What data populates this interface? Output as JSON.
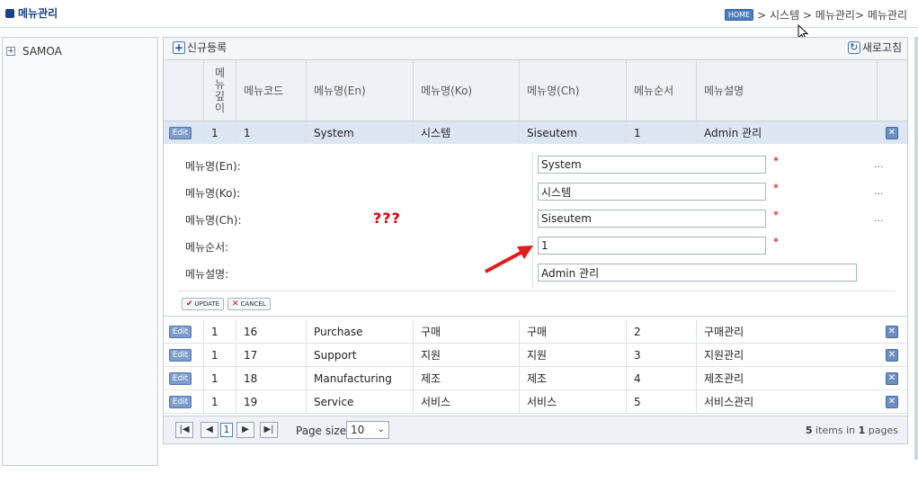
{
  "header": {
    "title": "메뉴관리",
    "breadcrumb": {
      "home_label": "HOME",
      "path": "> 시스템 > 메뉴관리> 메뉴관리"
    }
  },
  "sidebar": {
    "items": [
      {
        "label": "SAMOA",
        "expander": "+"
      }
    ]
  },
  "toolbar": {
    "new_label": "신규등록",
    "refresh_label": "새로고침"
  },
  "grid": {
    "columns": {
      "depth": [
        "메",
        "뉴",
        "깊",
        "이"
      ],
      "code": "메뉴코드",
      "name_en": "메뉴명(En)",
      "name_ko": "메뉴명(Ko)",
      "name_ch": "메뉴명(Ch)",
      "order": "메뉴순서",
      "desc": "메뉴설명"
    },
    "edit_label": "Edit",
    "delete_glyph": "✕",
    "selected_row": {
      "depth": "1",
      "code": "1",
      "name_en": "System",
      "name_ko": "시스템",
      "name_ch": "Siseutem",
      "order": "1",
      "desc": "Admin 관리"
    },
    "rows": [
      {
        "depth": "1",
        "code": "16",
        "name_en": "Purchase",
        "name_ko": "구매",
        "name_ch": "구매",
        "order": "2",
        "desc": "구매관리"
      },
      {
        "depth": "1",
        "code": "17",
        "name_en": "Support",
        "name_ko": "지원",
        "name_ch": "지원",
        "order": "3",
        "desc": "지원관리"
      },
      {
        "depth": "1",
        "code": "18",
        "name_en": "Manufacturing",
        "name_ko": "제조",
        "name_ch": "제조",
        "order": "4",
        "desc": "제조관리"
      },
      {
        "depth": "1",
        "code": "19",
        "name_en": "Service",
        "name_ko": "서비스",
        "name_ch": "서비스",
        "order": "5",
        "desc": "서비스관리"
      }
    ]
  },
  "edit_form": {
    "labels": {
      "name_en": "메뉴명(En):",
      "name_ko": "메뉴명(Ko):",
      "name_ch": "메뉴명(Ch):",
      "order": "메뉴순서:",
      "desc": "메뉴설명:"
    },
    "values": {
      "name_en": "System",
      "name_ko": "시스템",
      "name_ch": "Siseutem",
      "order": "1",
      "desc": "Admin 관리"
    },
    "required_mark": "*",
    "ellipsis": "...",
    "annotation": "???",
    "update_label": "UPDATE",
    "cancel_label": "CANCEL",
    "annotation_color": "#d40000"
  },
  "pager": {
    "current_page": "1",
    "page_size_label": "Page size:",
    "page_size_value": "10",
    "info_items": "5",
    "info_items_text": "items in",
    "info_pages": "1",
    "info_pages_text": "pages"
  }
}
